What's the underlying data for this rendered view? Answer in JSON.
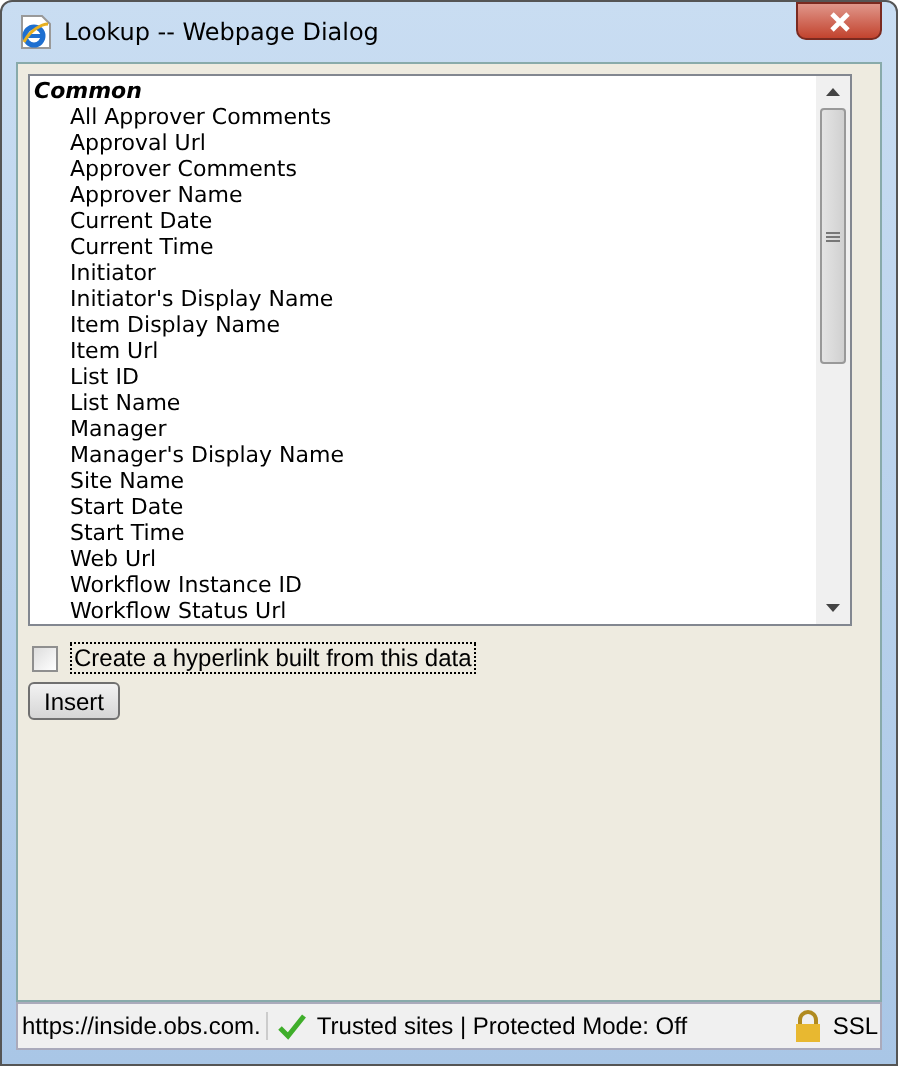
{
  "window": {
    "title": "Lookup -- Webpage Dialog"
  },
  "list": {
    "group": "Common",
    "items": [
      "All Approver Comments",
      "Approval Url",
      "Approver Comments",
      "Approver Name",
      "Current Date",
      "Current Time",
      "Initiator",
      "Initiator's Display Name",
      "Item Display Name",
      "Item Url",
      "List ID",
      "List Name",
      "Manager",
      "Manager's Display Name",
      "Site Name",
      "Start Date",
      "Start Time",
      "Web Url",
      "Workflow Instance ID",
      "Workflow Status Url"
    ]
  },
  "hyperlink_option": {
    "label": "Create a hyperlink built from this data",
    "checked": false
  },
  "buttons": [
    "Insert"
  ],
  "status_bar": {
    "address": "https://inside.obs.com.",
    "zone": "Trusted sites | Protected Mode: Off",
    "security": "SSL"
  }
}
